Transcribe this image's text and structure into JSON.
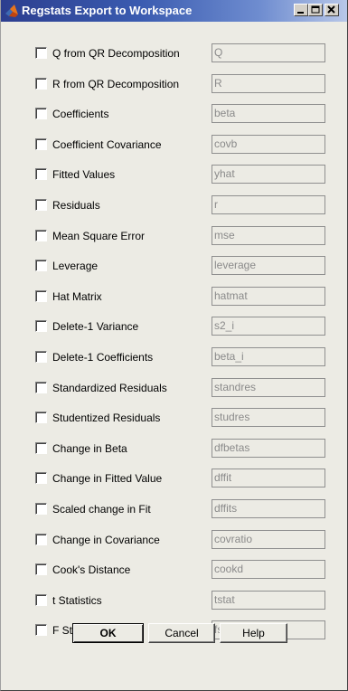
{
  "window": {
    "title": "Regstats Export to Workspace"
  },
  "rows": [
    {
      "label": "Q from QR Decomposition",
      "value": "Q",
      "checked": false
    },
    {
      "label": "R from QR Decomposition",
      "value": "R",
      "checked": false
    },
    {
      "label": "Coefficients",
      "value": "beta",
      "checked": false
    },
    {
      "label": "Coefficient Covariance",
      "value": "covb",
      "checked": false
    },
    {
      "label": "Fitted Values",
      "value": "yhat",
      "checked": false
    },
    {
      "label": "Residuals",
      "value": "r",
      "checked": false
    },
    {
      "label": "Mean Square Error",
      "value": "mse",
      "checked": false
    },
    {
      "label": "Leverage",
      "value": "leverage",
      "checked": false
    },
    {
      "label": "Hat Matrix",
      "value": "hatmat",
      "checked": false
    },
    {
      "label": "Delete-1 Variance",
      "value": "s2_i",
      "checked": false
    },
    {
      "label": "Delete-1 Coefficients",
      "value": "beta_i",
      "checked": false
    },
    {
      "label": "Standardized Residuals",
      "value": "standres",
      "checked": false
    },
    {
      "label": "Studentized Residuals",
      "value": "studres",
      "checked": false
    },
    {
      "label": "Change in Beta",
      "value": "dfbetas",
      "checked": false
    },
    {
      "label": "Change in Fitted Value",
      "value": "dffit",
      "checked": false
    },
    {
      "label": "Scaled change in Fit",
      "value": "dffits",
      "checked": false
    },
    {
      "label": "Change in Covariance",
      "value": "covratio",
      "checked": false
    },
    {
      "label": "Cook's Distance",
      "value": "cookd",
      "checked": false
    },
    {
      "label": "t Statistics",
      "value": "tstat",
      "checked": false
    },
    {
      "label": "F Statistic",
      "value": "fstat",
      "checked": false
    }
  ],
  "buttons": {
    "ok": "OK",
    "cancel": "Cancel",
    "help": "Help"
  },
  "colors": {
    "title_start": "#2c3e8f",
    "title_end": "#b8c7e8",
    "dialog_bg": "#ecebe4"
  }
}
